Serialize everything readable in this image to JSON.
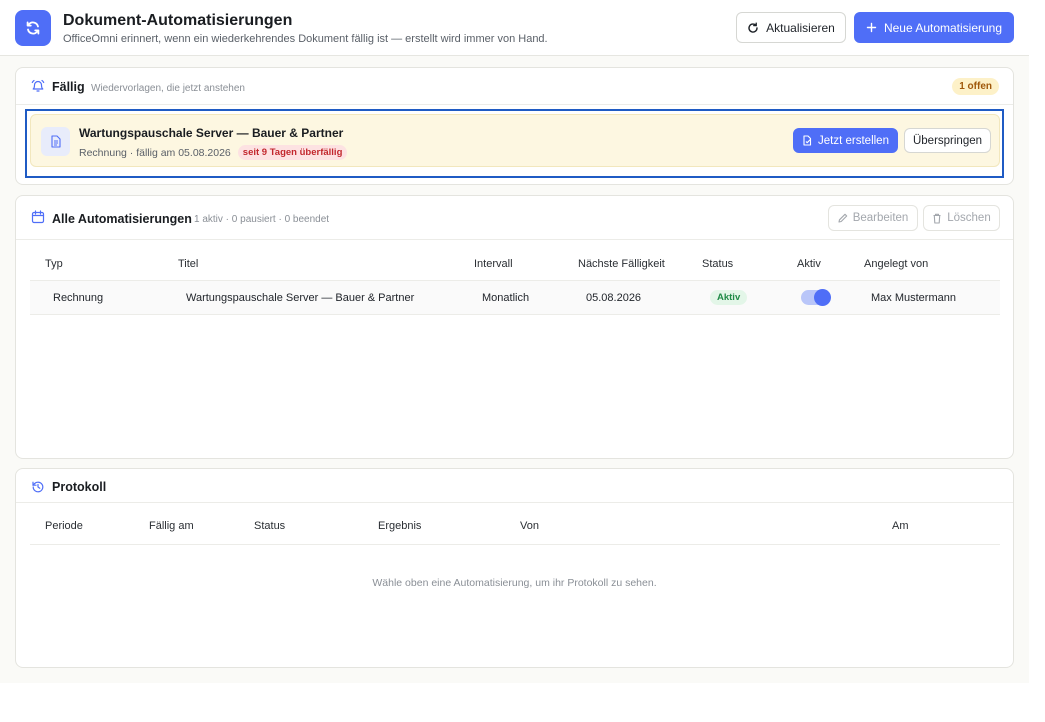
{
  "header": {
    "title": "Dokument-Automatisierungen",
    "subtitle": "OfficeOmni erinnert, wenn ein wiederkehrendes Dokument fällig ist — erstellt wird immer von Hand.",
    "refresh_label": "Aktualisieren",
    "new_label": "Neue Automatisierung"
  },
  "due": {
    "title": "Fällig",
    "hint": "Wiedervorlagen, die jetzt anstehen",
    "badge": "1 offen",
    "item": {
      "title": "Wartungspauschale Server — Bauer & Partner",
      "meta": "Rechnung · fällig am 05.08.2026",
      "overdue": "seit 9 Tagen überfällig",
      "create_label": "Jetzt erstellen",
      "skip_label": "Überspringen"
    }
  },
  "all": {
    "title": "Alle Automatisierungen",
    "hint": "1 aktiv · 0 pausiert · 0 beendet",
    "edit_label": "Bearbeiten",
    "delete_label": "Löschen",
    "columns": [
      "Typ",
      "Titel",
      "Intervall",
      "Nächste Fälligkeit",
      "Status",
      "Aktiv",
      "Angelegt von"
    ],
    "rows": [
      {
        "type": "Rechnung",
        "title": "Wartungspauschale Server — Bauer & Partner",
        "interval": "Monatlich",
        "next_due": "05.08.2026",
        "status": "Aktiv",
        "active": true,
        "created_by": "Max Mustermann"
      }
    ]
  },
  "log": {
    "title": "Protokoll",
    "columns": [
      "Periode",
      "Fällig am",
      "Status",
      "Ergebnis",
      "Von",
      "Am"
    ],
    "empty": "Wähle oben eine Automatisierung, um ihr Protokoll zu sehen."
  },
  "colors": {
    "accent": "#4f6ef7",
    "overdue": "#c2272d",
    "status_active": "#1f8a46",
    "highlight": "#1f5bc4"
  }
}
